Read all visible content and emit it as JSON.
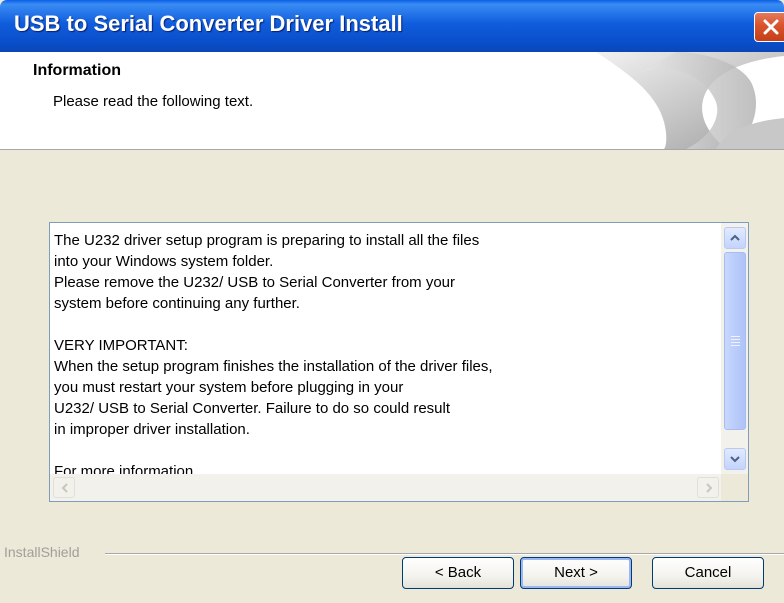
{
  "window": {
    "title": "USB to Serial Converter Driver Install"
  },
  "header": {
    "title": "Information",
    "subtitle": "Please read the following text."
  },
  "text_panel": {
    "lines": [
      "The U232 driver setup program is preparing to install all the files",
      "into your Windows system folder.",
      "Please remove the U232/ USB to Serial Converter from your",
      "system before continuing any further.",
      "",
      "VERY IMPORTANT:",
      "When the setup program finishes the installation of the driver files,",
      "you must restart your system before plugging in your",
      "U232/ USB to Serial Converter. Failure to do so could result",
      "in improper driver installation.",
      "",
      "For more information,"
    ]
  },
  "footer": {
    "brand": "InstallShield",
    "back_label": "< Back",
    "next_label": "Next >",
    "cancel_label": "Cancel"
  },
  "colors": {
    "titlebar": "#0A4FCB",
    "window_bg": "#ECE9D8",
    "close_button": "#D9532C",
    "scrollbar_thumb": "#BACCFB"
  },
  "icons": {
    "close": "close-x-icon",
    "scroll_up": "chevron-up-icon",
    "scroll_down": "chevron-down-icon",
    "scroll_left": "chevron-left-icon",
    "scroll_right": "chevron-right-icon"
  }
}
